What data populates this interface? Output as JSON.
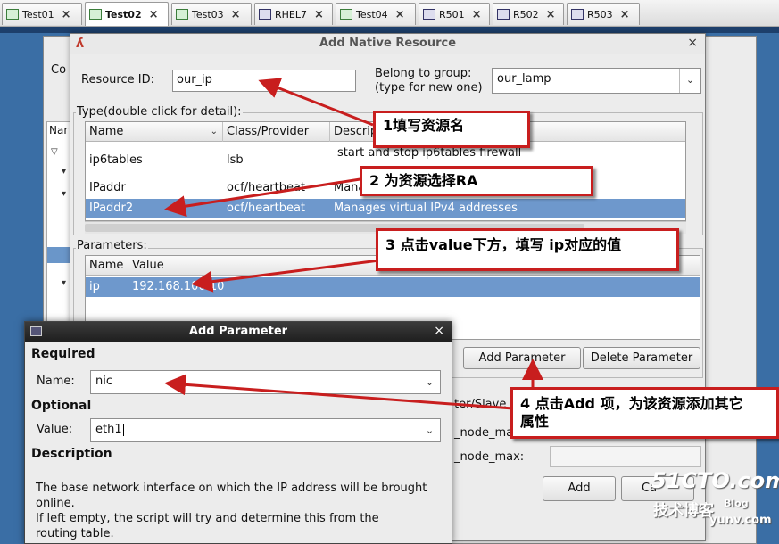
{
  "vm_tabs": [
    {
      "label": "Test01",
      "active": false
    },
    {
      "label": "Test02",
      "active": true
    },
    {
      "label": "Test03",
      "active": false
    },
    {
      "label": "RHEL7",
      "active": false
    },
    {
      "label": "Test04",
      "active": false
    },
    {
      "label": "R501",
      "active": false
    },
    {
      "label": "R502",
      "active": false
    },
    {
      "label": "R503",
      "active": false
    }
  ],
  "main_window": {
    "menu_fragment": "Co",
    "column_fragment": "Nar"
  },
  "add_resource_dialog": {
    "title": "Add Native Resource",
    "resource_id_label": "Resource ID:",
    "resource_id_value": "our_ip",
    "group_label_line1": "Belong to group:",
    "group_label_line2": "(type for new one)",
    "group_value": "our_lamp",
    "type_group_label": "Type(double click for detail):",
    "type_table": {
      "columns": [
        "Name",
        "Class/Provider",
        "Descrip"
      ],
      "rows": [
        {
          "name": "ip6tables",
          "provider": "lsb",
          "description": "start and stop ip6tables firewall",
          "selected": false
        },
        {
          "name": "IPaddr",
          "provider": "ocf/heartbeat",
          "description": "Mana",
          "selected": false
        },
        {
          "name": "IPaddr2",
          "provider": "ocf/heartbeat",
          "description": "Manages virtual IPv4 addresses",
          "selected": true
        }
      ]
    },
    "parameters_group_label": "Parameters:",
    "param_table": {
      "columns": [
        "Name",
        "Value"
      ],
      "rows": [
        {
          "name": "ip",
          "value": "192.168.100.10",
          "selected": true
        }
      ]
    },
    "add_parameter_button": "Add Parameter",
    "delete_parameter_button": "Delete Parameter",
    "master_slave_fragment": "ter/Slave ID",
    "node_max_fragment_1": "_node_max:",
    "node_max_fragment_2": "_node_max:",
    "add_button": "Add",
    "cancel_fragment": "Ca"
  },
  "add_parameter_dialog": {
    "title": "Add Parameter",
    "required_label": "Required",
    "name_label": "Name:",
    "name_value": "nic",
    "optional_label": "Optional",
    "value_label": "Value:",
    "value_value": "eth1",
    "description_label": "Description",
    "description_lines": [
      "The base network interface on which the IP address will be brought",
      "online.",
      "If left empty, the script will try and determine this from the",
      "routing table."
    ]
  },
  "annotations": [
    {
      "line1": "1填写资源名",
      "line2": ""
    },
    {
      "line1": "2 为资源选择RA",
      "line2": ""
    },
    {
      "line1": "3 点击value下方，填写 ip对应的值",
      "line2": ""
    },
    {
      "line1": "4 点击Add 项，为该资源添加其它",
      "line2": "属性"
    }
  ],
  "annotation_color": "#c81e1e",
  "watermark": {
    "line1": "51CTO.com",
    "line2": "技术博客",
    "line3": "Blog",
    "url": "yunv.com"
  }
}
